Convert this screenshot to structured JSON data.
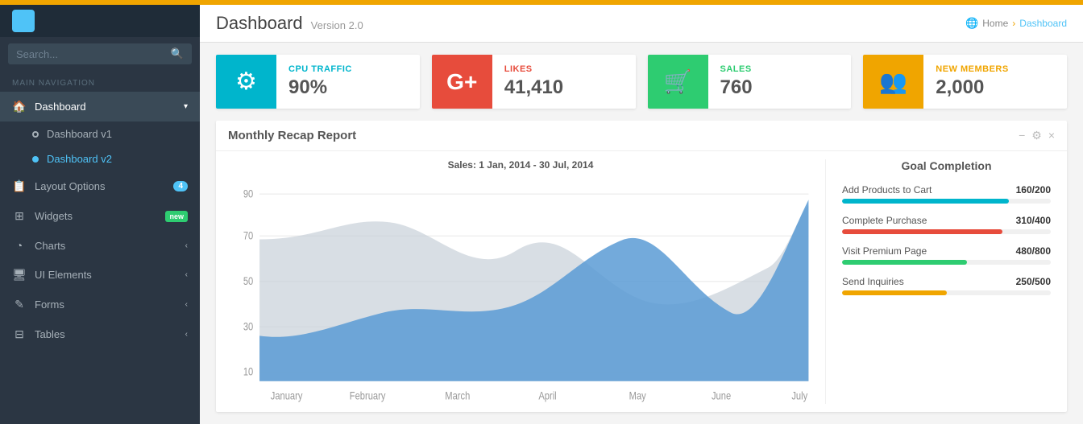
{
  "topbar": {},
  "sidebar": {
    "search_placeholder": "Search...",
    "nav_label": "MAIN NAVIGATION",
    "items": [
      {
        "id": "dashboard",
        "label": "Dashboard",
        "icon": "🏠",
        "has_arrow": true,
        "active": true
      },
      {
        "id": "dashboard-v1",
        "label": "Dashboard v1",
        "icon": "○",
        "sub": true,
        "active": false
      },
      {
        "id": "dashboard-v2",
        "label": "Dashboard v2",
        "icon": "●",
        "sub": true,
        "active": true
      },
      {
        "id": "layout-options",
        "label": "Layout Options",
        "icon": "📋",
        "badge": "4",
        "has_arrow": false
      },
      {
        "id": "widgets",
        "label": "Widgets",
        "icon": "⊞",
        "badge_new": "new",
        "has_arrow": false
      },
      {
        "id": "charts",
        "label": "Charts",
        "icon": "◔",
        "has_arrow": true
      },
      {
        "id": "ui-elements",
        "label": "UI Elements",
        "icon": "🖥",
        "has_arrow": true
      },
      {
        "id": "forms",
        "label": "Forms",
        "icon": "✎",
        "has_arrow": true
      },
      {
        "id": "tables",
        "label": "Tables",
        "icon": "⊟",
        "has_arrow": true
      }
    ]
  },
  "header": {
    "title": "Dashboard",
    "version": "Version 2.0",
    "breadcrumb": {
      "home": "Home",
      "current": "Dashboard"
    }
  },
  "stats": [
    {
      "id": "cpu",
      "label": "CPU TRAFFIC",
      "value": "90%",
      "color": "cyan",
      "icon": "⚙"
    },
    {
      "id": "likes",
      "label": "LIKES",
      "value": "41,410",
      "color": "red",
      "icon": "G+"
    },
    {
      "id": "sales",
      "label": "SALES",
      "value": "760",
      "color": "green",
      "icon": "🛒"
    },
    {
      "id": "members",
      "label": "NEW MEMBERS",
      "value": "2,000",
      "color": "orange",
      "icon": "👥"
    }
  ],
  "panel": {
    "title": "Monthly Recap Report",
    "chart_title": "Sales: 1 Jan, 2014 - 30 Jul, 2014",
    "controls": {
      "minimize": "−",
      "settings": "⚙",
      "close": "×"
    },
    "chart": {
      "y_labels": [
        "90",
        "70",
        "50",
        "30",
        "10"
      ],
      "x_labels": [
        "January",
        "February",
        "March",
        "April",
        "May",
        "June",
        "July"
      ]
    },
    "goals": {
      "title": "Goal Completion",
      "items": [
        {
          "label": "Add Products to Cart",
          "current": 160,
          "total": 200,
          "color": "cyan",
          "pct": 80
        },
        {
          "label": "Complete Purchase",
          "current": 310,
          "total": 400,
          "color": "red",
          "pct": 77
        },
        {
          "label": "Visit Premium Page",
          "current": 480,
          "total": 800,
          "color": "green",
          "pct": 60
        },
        {
          "label": "Send Inquiries",
          "current": 250,
          "total": 500,
          "color": "orange",
          "pct": 50
        }
      ]
    }
  }
}
